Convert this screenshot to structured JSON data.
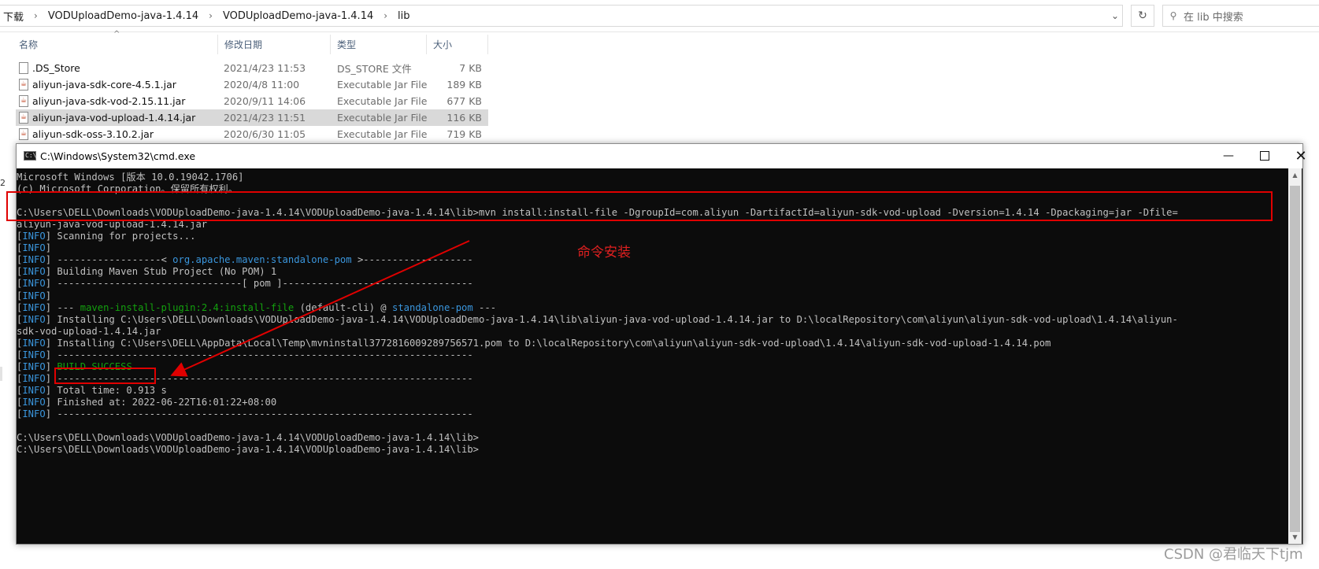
{
  "explorer": {
    "breadcrumbs": [
      "下载",
      "VODUploadDemo-java-1.4.14",
      "VODUploadDemo-java-1.4.14",
      "lib"
    ],
    "breadcrumb_separator": "›",
    "search_placeholder": "在 lib 中搜索",
    "columns": {
      "name": "名称",
      "date": "修改日期",
      "type": "类型",
      "size": "大小"
    },
    "files": [
      {
        "name": ".DS_Store",
        "date": "2021/4/23 11:53",
        "type": "DS_STORE 文件",
        "size": "7 KB",
        "selected": false,
        "icon": "file-icon"
      },
      {
        "name": "aliyun-java-sdk-core-4.5.1.jar",
        "date": "2020/4/8 11:00",
        "type": "Executable Jar File",
        "size": "189 KB",
        "selected": false,
        "icon": "jar-icon"
      },
      {
        "name": "aliyun-java-sdk-vod-2.15.11.jar",
        "date": "2020/9/11 14:06",
        "type": "Executable Jar File",
        "size": "677 KB",
        "selected": false,
        "icon": "jar-icon"
      },
      {
        "name": "aliyun-java-vod-upload-1.4.14.jar",
        "date": "2021/4/23 11:51",
        "type": "Executable Jar File",
        "size": "116 KB",
        "selected": true,
        "icon": "jar-icon"
      },
      {
        "name": "aliyun-sdk-oss-3.10.2.jar",
        "date": "2020/6/30 11:05",
        "type": "Executable Jar File",
        "size": "719 KB",
        "selected": false,
        "icon": "jar-icon"
      }
    ],
    "left_edge_mark": "2"
  },
  "cmd": {
    "title": "C:\\Windows\\System32\\cmd.exe",
    "lines": [
      [
        {
          "t": "Microsoft Windows [版本 10.0.19042.1706]"
        }
      ],
      [
        {
          "t": "(c) Microsoft Corporation。保留所有权利。"
        }
      ],
      [
        {
          "t": ""
        }
      ],
      [
        {
          "t": "C:\\Users\\DELL\\Downloads\\VODUploadDemo-java-1.4.14\\VODUploadDemo-java-1.4.14\\lib>mvn install:install-file -DgroupId=com.aliyun -DartifactId=aliyun-sdk-vod-upload -Dversion=1.4.14 -Dpackaging=jar -Dfile="
        }
      ],
      [
        {
          "t": "aliyun-java-vod-upload-1.4.14.jar"
        }
      ],
      [
        {
          "t": "[",
          "c": ""
        },
        {
          "t": "INFO",
          "c": "bl"
        },
        {
          "t": "] Scanning for projects..."
        }
      ],
      [
        {
          "t": "["
        },
        {
          "t": "INFO",
          "c": "bl"
        },
        {
          "t": "]"
        }
      ],
      [
        {
          "t": "["
        },
        {
          "t": "INFO",
          "c": "bl"
        },
        {
          "t": "] ------------------< "
        },
        {
          "t": "org.apache.maven:standalone-pom",
          "c": "cy"
        },
        {
          "t": " >-------------------"
        }
      ],
      [
        {
          "t": "["
        },
        {
          "t": "INFO",
          "c": "bl"
        },
        {
          "t": "] Building Maven Stub Project (No POM) 1"
        }
      ],
      [
        {
          "t": "["
        },
        {
          "t": "INFO",
          "c": "bl"
        },
        {
          "t": "] --------------------------------[ pom ]---------------------------------"
        }
      ],
      [
        {
          "t": "["
        },
        {
          "t": "INFO",
          "c": "bl"
        },
        {
          "t": "]"
        }
      ],
      [
        {
          "t": "["
        },
        {
          "t": "INFO",
          "c": "bl"
        },
        {
          "t": "] --- "
        },
        {
          "t": "maven-install-plugin:2.4:install-file",
          "c": "gr"
        },
        {
          "t": " (default-cli) @ "
        },
        {
          "t": "standalone-pom",
          "c": "cy"
        },
        {
          "t": " ---"
        }
      ],
      [
        {
          "t": "["
        },
        {
          "t": "INFO",
          "c": "bl"
        },
        {
          "t": "] Installing C:\\Users\\DELL\\Downloads\\VODUploadDemo-java-1.4.14\\VODUploadDemo-java-1.4.14\\lib\\aliyun-java-vod-upload-1.4.14.jar to D:\\localRepository\\com\\aliyun\\aliyun-sdk-vod-upload\\1.4.14\\aliyun-"
        }
      ],
      [
        {
          "t": "sdk-vod-upload-1.4.14.jar"
        }
      ],
      [
        {
          "t": "["
        },
        {
          "t": "INFO",
          "c": "bl"
        },
        {
          "t": "] Installing C:\\Users\\DELL\\AppData\\Local\\Temp\\mvninstall3772816009289756571.pom to D:\\localRepository\\com\\aliyun\\aliyun-sdk-vod-upload\\1.4.14\\aliyun-sdk-vod-upload-1.4.14.pom"
        }
      ],
      [
        {
          "t": "["
        },
        {
          "t": "INFO",
          "c": "bl"
        },
        {
          "t": "] ------------------------------------------------------------------------"
        }
      ],
      [
        {
          "t": "["
        },
        {
          "t": "INFO",
          "c": "bl"
        },
        {
          "t": "] "
        },
        {
          "t": "BUILD SUCCESS",
          "c": "gr"
        }
      ],
      [
        {
          "t": "["
        },
        {
          "t": "INFO",
          "c": "bl"
        },
        {
          "t": "] ------------------------------------------------------------------------"
        }
      ],
      [
        {
          "t": "["
        },
        {
          "t": "INFO",
          "c": "bl"
        },
        {
          "t": "] Total time: 0.913 s"
        }
      ],
      [
        {
          "t": "["
        },
        {
          "t": "INFO",
          "c": "bl"
        },
        {
          "t": "] Finished at: 2022-06-22T16:01:22+08:00"
        }
      ],
      [
        {
          "t": "["
        },
        {
          "t": "INFO",
          "c": "bl"
        },
        {
          "t": "] ------------------------------------------------------------------------"
        }
      ],
      [
        {
          "t": ""
        }
      ],
      [
        {
          "t": "C:\\Users\\DELL\\Downloads\\VODUploadDemo-java-1.4.14\\VODUploadDemo-java-1.4.14\\lib>"
        }
      ],
      [
        {
          "t": "C:\\Users\\DELL\\Downloads\\VODUploadDemo-java-1.4.14\\VODUploadDemo-java-1.4.14\\lib>"
        }
      ]
    ]
  },
  "annotation": {
    "label": "命令安装",
    "color": "#e00000"
  },
  "watermark": "CSDN @君临天下tjm",
  "colors": {
    "console_bg": "#0c0c0c",
    "console_text": "#c0c0c0",
    "info_blue": "#3a96dd",
    "success_green": "#13a10e",
    "selection": "#d9d9d9"
  }
}
